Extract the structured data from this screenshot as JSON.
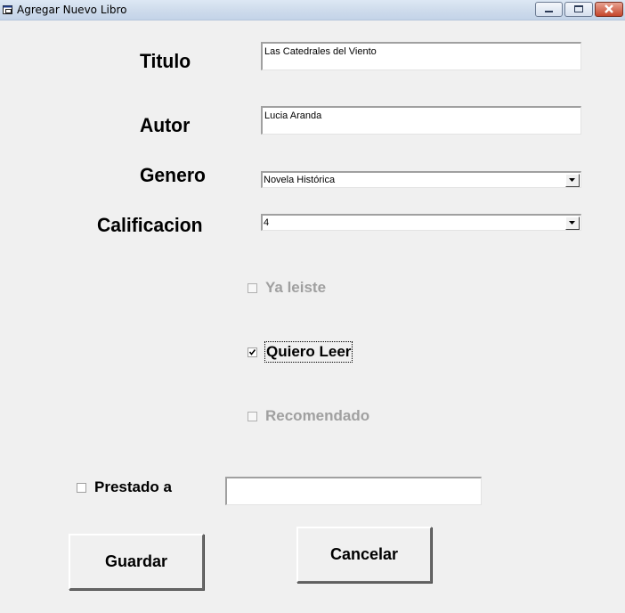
{
  "window": {
    "title": "Agregar Nuevo Libro"
  },
  "form": {
    "titulo_label": "Titulo",
    "titulo_value": "Las Catedrales del Viento",
    "autor_label": "Autor",
    "autor_value": "Lucia Aranda",
    "genero_label": "Genero",
    "genero_value": "Novela Histórica",
    "calificacion_label": "Calificacion",
    "calificacion_value": "4",
    "ya_leiste": {
      "label": "Ya leiste",
      "checked": false,
      "enabled": false
    },
    "quiero_leer": {
      "label": "Quiero Leer",
      "checked": true,
      "enabled": true
    },
    "recomendado": {
      "label": "Recomendado",
      "checked": false,
      "enabled": false
    },
    "prestado": {
      "label": "Prestado a",
      "checked": false,
      "enabled": true,
      "value": ""
    }
  },
  "buttons": {
    "guardar": "Guardar",
    "cancelar": "Cancelar"
  }
}
